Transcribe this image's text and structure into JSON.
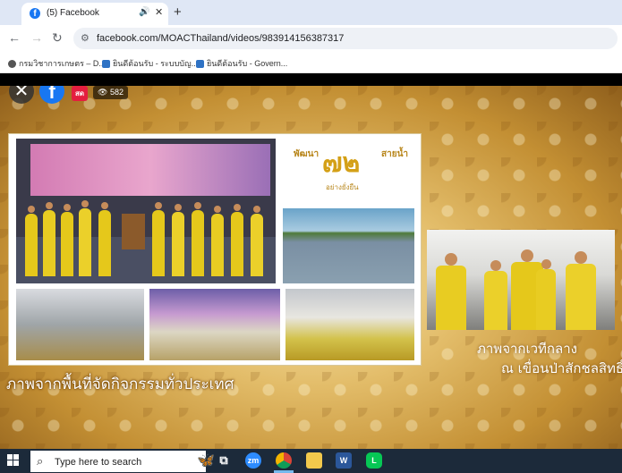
{
  "browser": {
    "tab_title": "(5) Facebook",
    "tab_icon": "facebook-icon",
    "tab_audio_icon": "speaker-icon",
    "new_tab_label": "+",
    "url": "facebook.com/MOACThailand/videos/983914156387317",
    "bookmarks": [
      {
        "label": "กรมวิชาการเกษตร – D..."
      },
      {
        "label": "ยินดีต้อนรับ - ระบบบัญ..."
      },
      {
        "label": "ยินดีต้อนรับ - Govern..."
      }
    ]
  },
  "video": {
    "live_label": "สด",
    "viewer_count": "582",
    "logo_panel": {
      "top_left": "พัฒนา",
      "big_number": "๗๒",
      "top_right": "สายน้ำ",
      "bottom": "อย่างยั่งยืน"
    },
    "main_caption": "ภาพจากพื้นที่จัดกิจกรรมทั่วประเทศ",
    "stage_caption_line1": "ภาพจากเวทีกลาง",
    "stage_caption_line2": "ณ เขื่อนป่าสักชลสิทธิ์"
  },
  "taskbar": {
    "search_placeholder": "Type here to search",
    "apps": [
      "task-view",
      "zoom",
      "chrome",
      "file-explorer",
      "word",
      "line"
    ]
  },
  "colors": {
    "facebook_blue": "#1877f2",
    "live_red": "#e41e3f",
    "gold_bg": "#c38f33",
    "taskbar": "#1c2a3a"
  }
}
